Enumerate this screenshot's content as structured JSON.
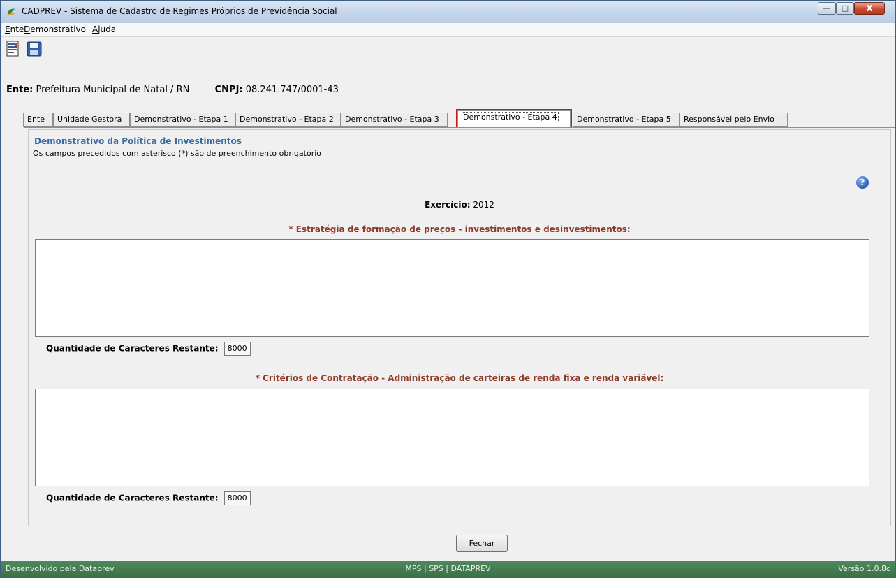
{
  "window": {
    "title": "CADPREV - Sistema de Cadastro de Regimes Próprios de Previdência Social",
    "controls": {
      "minimize": "—",
      "maximize": "□",
      "close": "X"
    }
  },
  "menu": {
    "items": [
      {
        "first": "E",
        "rest": "nte"
      },
      {
        "first": "D",
        "rest": "emonstrativo"
      },
      {
        "first": "A",
        "rest": "juda"
      }
    ]
  },
  "toolbar": {
    "items": [
      "document-report-icon",
      "save-icon"
    ]
  },
  "ente": {
    "label": "Ente:",
    "value": "Prefeitura Municipal de Natal / RN",
    "cnpj_label": "CNPJ:",
    "cnpj_value": "08.241.747/0001-43"
  },
  "tabs": [
    {
      "label": "Ente"
    },
    {
      "label": "Unidade Gestora"
    },
    {
      "label": "Demonstrativo - Etapa 1"
    },
    {
      "label": "Demonstrativo - Etapa 2"
    },
    {
      "label": "Demonstrativo - Etapa 3"
    },
    {
      "label": "Demonstrativo - Etapa 4",
      "active": true
    },
    {
      "label": "Demonstrativo - Etapa 5"
    },
    {
      "label": "Responsável pelo Envio"
    }
  ],
  "section": {
    "title": "Demonstrativo da Política de Investimentos",
    "note": "Os campos precedidos com asterisco (*) são de preenchimento obrigatório"
  },
  "exercicio": {
    "label": "Exercício:",
    "value": "2012"
  },
  "fields": [
    {
      "label": "* Estratégia de formação de preços - investimentos e desinvestimentos:",
      "value": "",
      "remaining_label": "Quantidade de Caracteres Restante:",
      "remaining": "8000"
    },
    {
      "label": "* Critérios de Contratação - Administração de carteiras de renda fixa e renda variável:",
      "value": "",
      "remaining_label": "Quantidade de Caracteres Restante:",
      "remaining": "8000"
    }
  ],
  "buttons": {
    "close_label": "Fechar"
  },
  "status": {
    "left": "Desenvolvido pela Dataprev",
    "center": "MPS | SPS | DATAPREV",
    "right": "Versão 1.0.8d"
  },
  "colors": {
    "accent": "#3a6aa0",
    "field_label": "#8e3a2a",
    "status_bar": "#3b7048",
    "active_tab_highlight": "#c41c1c"
  }
}
